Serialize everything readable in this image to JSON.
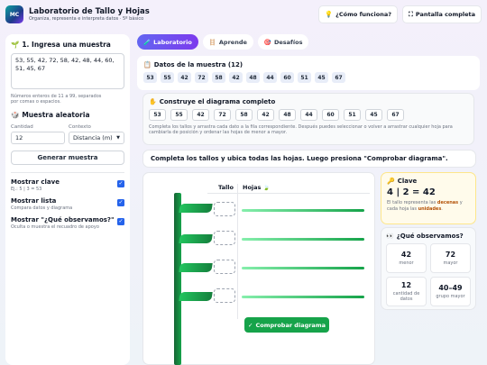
{
  "app": {
    "logo_text": "MC",
    "title": "Laboratorio de Tallo y Hojas",
    "subtitle": "Organiza, representa e interpreta datos · 5º básico",
    "help_label": "¿Cómo funciona?",
    "fullscreen_label": "Pantalla completa"
  },
  "sidebar": {
    "sample_heading": "1. Ingresa una muestra",
    "sample_value": "53, 55, 42, 72, 58, 42, 48, 44, 60, 51, 45, 67",
    "sample_hint": "Números enteros de 11 a 99, separados por comas o espacios.",
    "random_heading": "Muestra aleatoria",
    "count_label": "Cantidad",
    "count_value": "12",
    "context_label": "Contexto",
    "context_value": "Distancia (m)",
    "generate_label": "Generar muestra",
    "options": [
      {
        "title": "Mostrar clave",
        "desc": "Ej.: 5 | 3 = 53",
        "checked": true
      },
      {
        "title": "Mostrar lista",
        "desc": "Compara datos y diagrama",
        "checked": true
      },
      {
        "title": "Mostrar \"¿Qué observamos?\"",
        "desc": "Oculta o muestra el recuadro de apoyo",
        "checked": true
      }
    ]
  },
  "tabs": [
    {
      "label": "Laboratorio",
      "active": true
    },
    {
      "label": "Aprende",
      "active": false
    },
    {
      "label": "Desafíos",
      "active": false
    }
  ],
  "data_card": {
    "heading": "Datos de la muestra (12)",
    "values": [
      "53",
      "55",
      "42",
      "72",
      "58",
      "42",
      "48",
      "44",
      "60",
      "51",
      "45",
      "67"
    ]
  },
  "build_card": {
    "heading": "Construye el diagrama completo",
    "chips": [
      "53",
      "55",
      "42",
      "72",
      "58",
      "42",
      "48",
      "44",
      "60",
      "51",
      "45",
      "67"
    ],
    "note": "Completa los tallos y arrastra cada dato a la fila correspondiente. Después puedes seleccionar o volver a arrastrar cualquier hoja para cambiarla de posición y ordenar las hojas de menor a mayor."
  },
  "instruction": "Completa los tallos y ubica todas las hojas. Luego presiona \"Comprobar diagrama\".",
  "plot": {
    "col_stem": "Tallo",
    "col_leaves": "Hojas",
    "check_label": "Comprobar diagrama"
  },
  "key": {
    "heading": "Clave",
    "example": "4 | 2 = 42",
    "note_pre": "El tallo representa las ",
    "note_b1": "decenas",
    "note_mid": " y cada hoja las ",
    "note_b2": "unidades",
    "note_end": "."
  },
  "observe": {
    "heading": "¿Qué observamos?",
    "cells": [
      {
        "value": "42",
        "label": "menor"
      },
      {
        "value": "72",
        "label": "mayor"
      },
      {
        "value": "12",
        "label": "cantidad de datos"
      },
      {
        "value": "40–49",
        "label": "grupo mayor"
      }
    ]
  }
}
